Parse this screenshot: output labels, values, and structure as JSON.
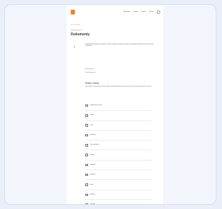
{
  "nav": {
    "items": [
      "Ubezpieczenia",
      "Inwestycje",
      "Emerytura",
      "Dla firmy"
    ]
  },
  "breadcrumb": {
    "home": "Start",
    "sep": ">",
    "current": "Dokumenty"
  },
  "page": {
    "eyebrow": "Materiały do pobrania",
    "title": "Dokumenty",
    "intro": "Wszystkie dokumenty dotyczące ubezpieczeń, inwestycji i programów emerytalnych w jednym miejscu. Wybierz kategorię, aby znaleźć interesujący Cię dokument.",
    "filter_label": "Rodzaj dokumentu",
    "filter_value": "Wszystkie dokumenty"
  },
  "section": {
    "title": "Polisy i oferty",
    "desc": "Sprawdź ogólne warunki ubezpieczenia, karty produktów i inne dokumenty dla wybranego produktu. Dokumenty są dostępne do pobrania w formacie PDF."
  },
  "list": [
    {
      "label": "Ubezpieczenie na życie",
      "icon": "shield-icon"
    },
    {
      "label": "Zdrowie",
      "icon": "heart-icon"
    },
    {
      "label": "Dzieci",
      "icon": "child-icon"
    },
    {
      "label": "Samochód",
      "icon": "car-icon"
    },
    {
      "label": "Dom i mieszkanie",
      "icon": "home-icon"
    },
    {
      "label": "Podróże",
      "icon": "plane-icon"
    },
    {
      "label": "Inwestycje",
      "icon": "chart-icon"
    },
    {
      "label": "Emerytura",
      "icon": "piggy-icon"
    },
    {
      "label": "Firma",
      "icon": "briefcase-icon"
    },
    {
      "label": "Rolnictwo",
      "icon": "tractor-icon"
    },
    {
      "label": "Pozostałe",
      "icon": "document-icon"
    }
  ],
  "colors": {
    "accent": "#f5821f"
  }
}
